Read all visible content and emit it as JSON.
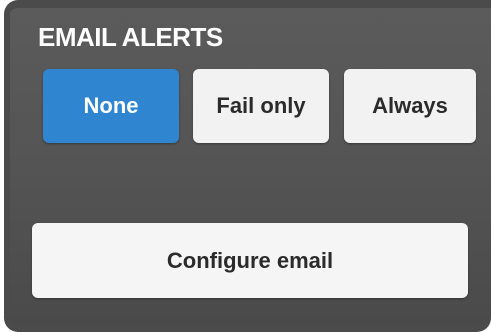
{
  "section": {
    "title": "EMAIL ALERTS"
  },
  "alert_mode": {
    "selected": "None",
    "options": [
      {
        "label": "None"
      },
      {
        "label": "Fail only"
      },
      {
        "label": "Always"
      }
    ]
  },
  "actions": {
    "configure_label": "Configure email"
  },
  "colors": {
    "selected": "#2f85d0",
    "button": "#f2f2f2",
    "panel": "#555555",
    "title_text": "#ffffff"
  }
}
